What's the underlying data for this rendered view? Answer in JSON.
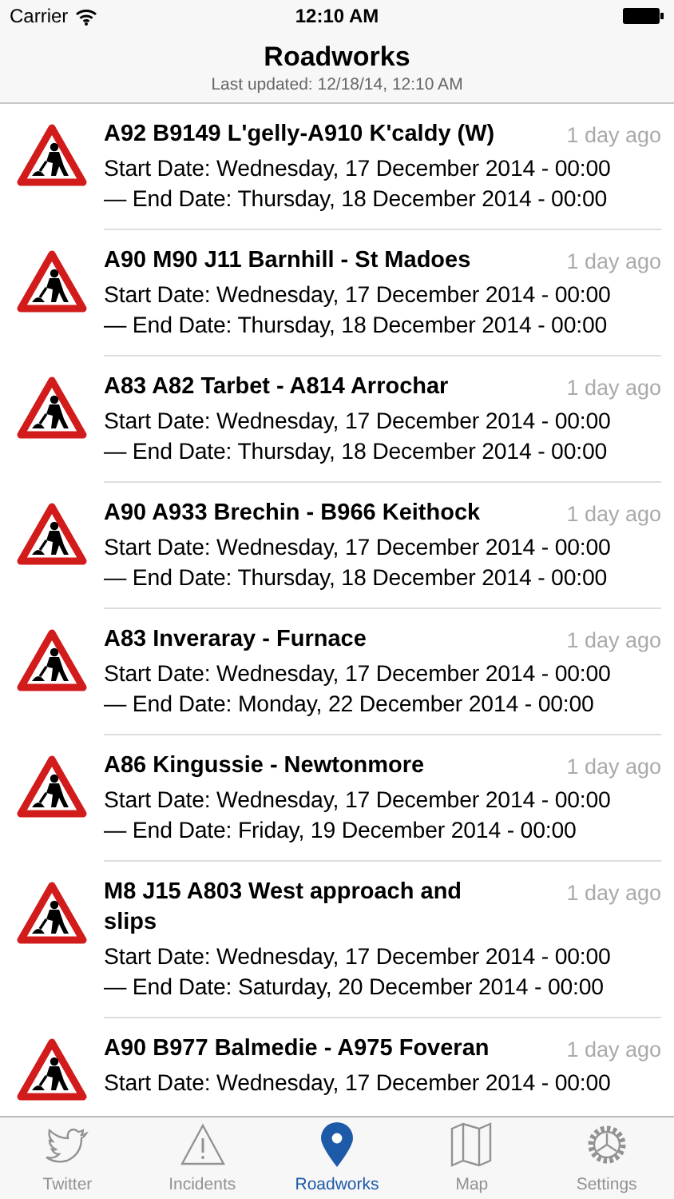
{
  "status_bar": {
    "carrier": "Carrier",
    "time": "12:10 AM"
  },
  "nav": {
    "title": "Roadworks",
    "subtitle": "Last updated: 12/18/14, 12:10 AM"
  },
  "items": [
    {
      "title": "A92 B9149 L'gelly-A910 K'caldy (W)",
      "time": "1 day ago",
      "start": "Start Date: Wednesday, 17 December 2014 - 00:00",
      "end": "— End Date: Thursday, 18 December 2014 - 00:00"
    },
    {
      "title": "A90 M90 J11 Barnhill - St Madoes",
      "time": "1 day ago",
      "start": "Start Date: Wednesday, 17 December 2014 - 00:00",
      "end": "— End Date: Thursday, 18 December 2014 - 00:00"
    },
    {
      "title": "A83 A82 Tarbet - A814 Arrochar",
      "time": "1 day ago",
      "start": "Start Date: Wednesday, 17 December 2014 - 00:00",
      "end": "— End Date: Thursday, 18 December 2014 - 00:00"
    },
    {
      "title": "A90 A933 Brechin - B966 Keithock",
      "time": "1 day ago",
      "start": "Start Date: Wednesday, 17 December 2014 - 00:00",
      "end": "— End Date: Thursday, 18 December 2014 - 00:00"
    },
    {
      "title": "A83 Inveraray - Furnace",
      "time": "1 day ago",
      "start": "Start Date: Wednesday, 17 December 2014 - 00:00",
      "end": "— End Date: Monday, 22 December 2014 - 00:00"
    },
    {
      "title": "A86 Kingussie - Newtonmore",
      "time": "1 day ago",
      "start": "Start Date: Wednesday, 17 December 2014 - 00:00",
      "end": "— End Date: Friday, 19 December 2014 - 00:00"
    },
    {
      "title": "M8 J15 A803 West approach and slips",
      "time": "1 day ago",
      "start": "Start Date: Wednesday, 17 December 2014 - 00:00",
      "end": "— End Date: Saturday, 20 December 2014 - 00:00"
    },
    {
      "title": "A90 B977 Balmedie - A975 Foveran",
      "time": "1 day ago",
      "start": "Start Date: Wednesday, 17 December 2014 - 00:00"
    }
  ],
  "tabs": [
    {
      "label": "Twitter",
      "kind": "bird",
      "selected": false
    },
    {
      "label": "Incidents",
      "kind": "warning",
      "selected": false
    },
    {
      "label": "Roadworks",
      "kind": "pin",
      "selected": true
    },
    {
      "label": "Map",
      "kind": "map",
      "selected": false
    },
    {
      "label": "Settings",
      "kind": "gear",
      "selected": false
    }
  ]
}
